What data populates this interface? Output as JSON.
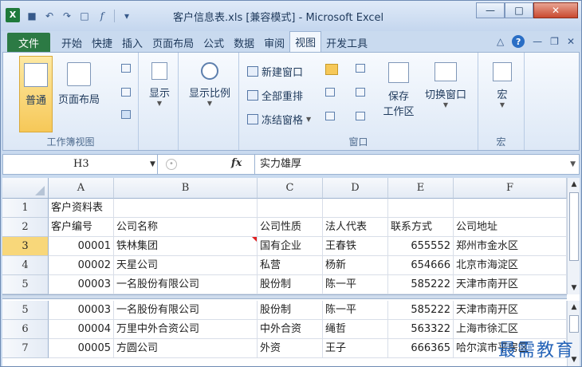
{
  "window": {
    "title": "客户信息表.xls  [兼容模式] - Microsoft Excel",
    "app_icon_label": "X"
  },
  "ribbon_tabs": [
    "文件",
    "开始",
    "快捷",
    "插入",
    "页面布局",
    "公式",
    "数据",
    "审阅",
    "视图",
    "开发工具"
  ],
  "active_tab": "视图",
  "groups": {
    "workbook_views": {
      "label": "工作簿视图",
      "normal": "普通",
      "page_layout": "页面布局"
    },
    "show": {
      "label": "显示"
    },
    "zoom": {
      "label": "显示比例"
    },
    "window": {
      "label": "窗口",
      "new_window": "新建窗口",
      "arrange_all": "全部重排",
      "freeze_panes": "冻结窗格",
      "save_workspace_1": "保存",
      "save_workspace_2": "工作区",
      "switch_window": "切换窗口"
    },
    "macros": {
      "label": "宏",
      "macros": "宏"
    }
  },
  "formula_bar": {
    "name_box": "H3",
    "fx": "fx",
    "content": "实力雄厚"
  },
  "columns": [
    "A",
    "B",
    "C",
    "D",
    "E",
    "F"
  ],
  "top_pane": {
    "rows": [
      {
        "num": "1",
        "cells": [
          "客户资料表",
          "",
          "",
          "",
          "",
          ""
        ]
      },
      {
        "num": "2",
        "cells": [
          "客户编号",
          "公司名称",
          "公司性质",
          "法人代表",
          "联系方式",
          "公司地址"
        ]
      },
      {
        "num": "3",
        "cells": [
          "00001",
          "铁林集团",
          "国有企业",
          "王春铁",
          "655552",
          "郑州市金水区"
        ]
      },
      {
        "num": "4",
        "cells": [
          "00002",
          "天星公司",
          "私营",
          "杨新",
          "654666",
          "北京市海淀区"
        ]
      },
      {
        "num": "5",
        "cells": [
          "00003",
          "一名股份有限公司",
          "股份制",
          "陈一平",
          "585222",
          "天津市南开区"
        ]
      }
    ]
  },
  "bottom_pane": {
    "rows": [
      {
        "num": "5",
        "cells": [
          "00003",
          "一名股份有限公司",
          "股份制",
          "陈一平",
          "585222",
          "天津市南开区"
        ]
      },
      {
        "num": "6",
        "cells": [
          "00004",
          "万里中外合资公司",
          "中外合资",
          "绳哲",
          "563322",
          "上海市徐汇区"
        ]
      },
      {
        "num": "7",
        "cells": [
          "00005",
          "方圆公司",
          "外资",
          "王子",
          "666365",
          "哈尔滨市平房区"
        ]
      }
    ]
  },
  "watermark": "最需教育"
}
